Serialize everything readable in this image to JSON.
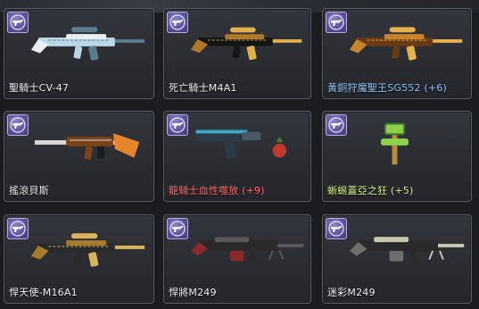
{
  "inventory": {
    "items": [
      {
        "name": "聖騎士CV-47",
        "color": "#f0f0f0",
        "icon": "rifle-icon",
        "palette": [
          "#b9d7e6",
          "#e8eef2",
          "#5a7c8f"
        ]
      },
      {
        "name": "死亡騎士M4A1",
        "color": "#f0f0f0",
        "icon": "rifle-icon",
        "palette": [
          "#151515",
          "#b07a2a",
          "#e0b04a"
        ]
      },
      {
        "name": "黃銅狩魔聖王SG552 (+6)",
        "color": "#8fc4f2",
        "icon": "rifle-icon",
        "palette": [
          "#6a3a14",
          "#c8842a",
          "#e8b04a"
        ]
      },
      {
        "name": "搖滾貝斯",
        "color": "#f0f0f0",
        "icon": "guitar-rifle-icon",
        "palette": [
          "#7a4218",
          "#e6852a",
          "#d9d9d9"
        ]
      },
      {
        "name": "龍騎士血性噬放 (+9)",
        "color": "#ff6e6e",
        "icon": "blaster-icon",
        "palette": [
          "#2b3a44",
          "#3fa8c8",
          "#c0392b"
        ]
      },
      {
        "name": "蜥蜴蓋亞之狂 (+5)",
        "color": "#d8f08a",
        "icon": "hammer-icon",
        "palette": [
          "#3a7a2a",
          "#8ed04a",
          "#b88c3a"
        ]
      },
      {
        "name": "悍天使-M16A1",
        "color": "#f0f0f0",
        "icon": "rifle-icon",
        "palette": [
          "#2a2a2a",
          "#a67c2a",
          "#d8b45a"
        ]
      },
      {
        "name": "悍將M249",
        "color": "#f0f0f0",
        "icon": "machine-gun-icon",
        "palette": [
          "#2a2a2a",
          "#8a2a2a",
          "#5a5a5a"
        ]
      },
      {
        "name": "迷彩M249",
        "color": "#f0f0f0",
        "icon": "machine-gun-icon",
        "palette": [
          "#2a2a2a",
          "#6e6e6e",
          "#c8c8b0"
        ]
      }
    ]
  },
  "badge": {
    "icon": "revolver-icon",
    "color": "#5a4f98"
  }
}
